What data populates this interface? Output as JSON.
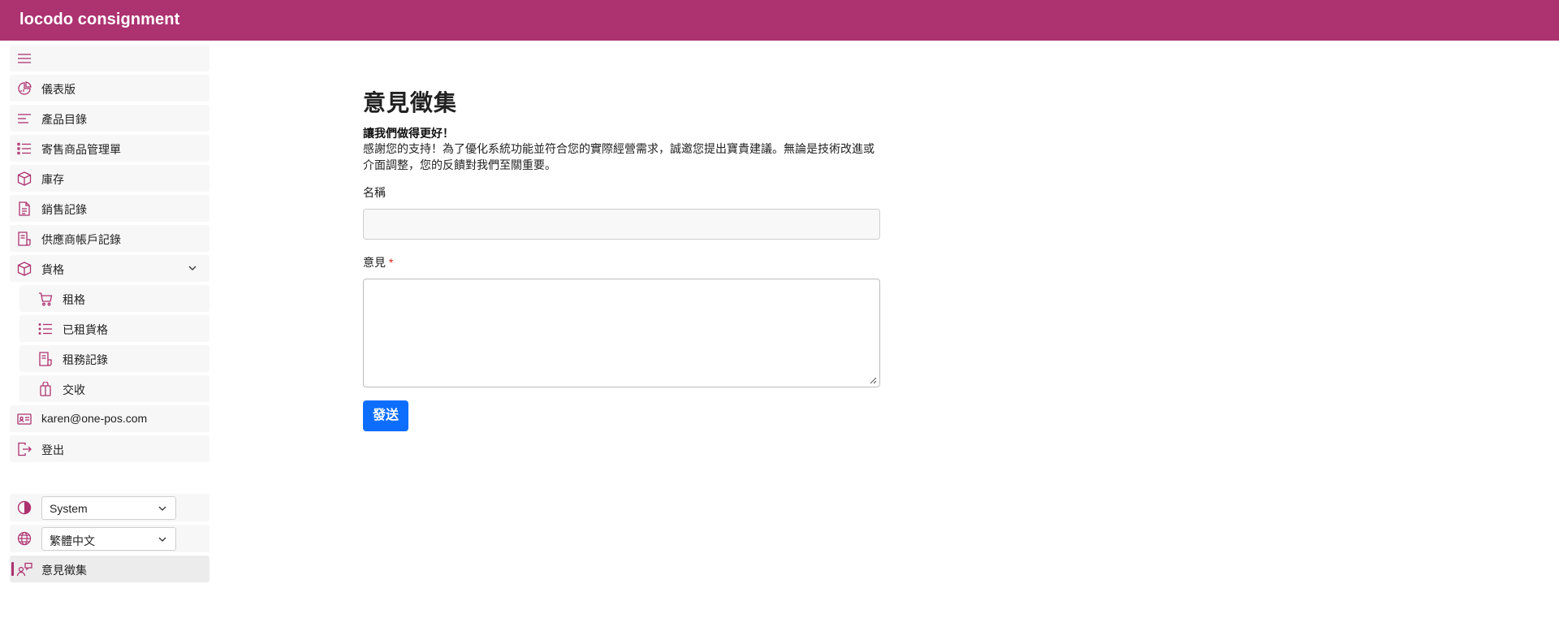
{
  "app": {
    "title": "locodo consignment"
  },
  "sidebar": {
    "items": [
      {
        "label": "儀表版",
        "icon": "dashboard-icon"
      },
      {
        "label": "產品目錄",
        "icon": "lines-icon"
      },
      {
        "label": "寄售商品管理單",
        "icon": "list-icon"
      },
      {
        "label": "庫存",
        "icon": "box-icon"
      },
      {
        "label": "銷售記錄",
        "icon": "document-icon"
      },
      {
        "label": "供應商帳戶記錄",
        "icon": "receipt-icon"
      },
      {
        "label": "貨格",
        "icon": "box-icon"
      }
    ],
    "subitems": [
      {
        "label": "租格",
        "icon": "cart-icon"
      },
      {
        "label": "已租貨格",
        "icon": "list-icon"
      },
      {
        "label": "租務記錄",
        "icon": "receipt-icon"
      },
      {
        "label": "交收",
        "icon": "bag-icon"
      }
    ],
    "account": {
      "label": "karen@one-pos.com",
      "icon": "id-card-icon"
    },
    "logout": {
      "label": "登出",
      "icon": "logout-icon"
    },
    "theme": {
      "value": "System",
      "icon": "contrast-icon"
    },
    "language": {
      "value": "繁體中文",
      "icon": "globe-icon"
    },
    "feedback": {
      "label": "意見徵集",
      "icon": "feedback-icon"
    }
  },
  "main": {
    "title": "意見徵集",
    "lead": "讓我們做得更好！",
    "description": "感謝您的支持！為了優化系統功能並符合您的實際經營需求，誠邀您提出寶貴建議。無論是技術改進或介面調整，您的反饋對我們至關重要。",
    "name_label": "名稱",
    "name_value": "",
    "comment_label": "意見",
    "required_mark": "*",
    "comment_value": "",
    "submit_label": "發送"
  },
  "colors": {
    "brand": "#ad3270",
    "primary": "#0d6efd"
  }
}
